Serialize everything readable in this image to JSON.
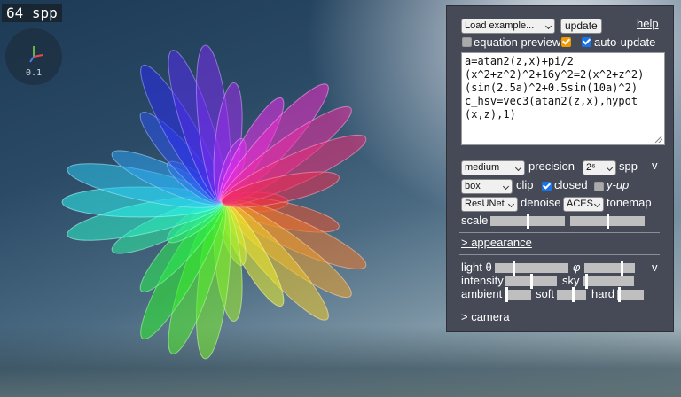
{
  "viewport": {
    "spp_label": "64 spp",
    "axes_scale": "0.1"
  },
  "panel": {
    "example_select": "Load example...",
    "update_button": "update",
    "help_link": "help",
    "equation_preview_label": "equation preview",
    "equation_preview_checked": false,
    "auto_update_label": "auto-update",
    "auto_update_checked": true,
    "equation_text": "a=atan2(z,x)+pi/2\n(x^2+z^2)^2+16y^2=2(x^2+z^2)\n(sin(2.5a)^2+0.5sin(10a)^2)\nc_hsv=vec3(atan2(z,x),hypot\n(x,z),1)",
    "render": {
      "quality_select": "medium",
      "precision_label": "precision",
      "spp_select": "2⁶",
      "spp_label": "spp",
      "collapse_label": "v",
      "clip_select": "box",
      "clip_label": "clip",
      "closed_label": "closed",
      "closed_checked": true,
      "yup_label": "y-up",
      "yup_checked": false,
      "denoise_select": "ResUNet",
      "denoise_label": "denoise",
      "tonemap_select": "ACES",
      "tonemap_label": "tonemap",
      "scale_label": "scale",
      "scale_value_1": 0.5,
      "scale_value_2": 0.5
    },
    "appearance_link": "> appearance",
    "lighting": {
      "light_theta_label": "light θ",
      "light_theta_value": 0.25,
      "phi_label": "φ",
      "phi_value": 0.75,
      "collapse_label": "v",
      "intensity_label": "intensity",
      "intensity_value": 0.5,
      "sky_label": "sky",
      "sky_value": 0.05,
      "ambient_label": "ambient",
      "ambient_value": 0.02,
      "soft_label": "soft",
      "soft_value": 0.55,
      "hard_label": "hard",
      "hard_value": 0.05
    },
    "camera_link": "> camera"
  },
  "colors": {
    "panel_bg": "#454a56",
    "checkbox_blue": "#1a73e8",
    "checkbox_orange": "#f29900"
  }
}
